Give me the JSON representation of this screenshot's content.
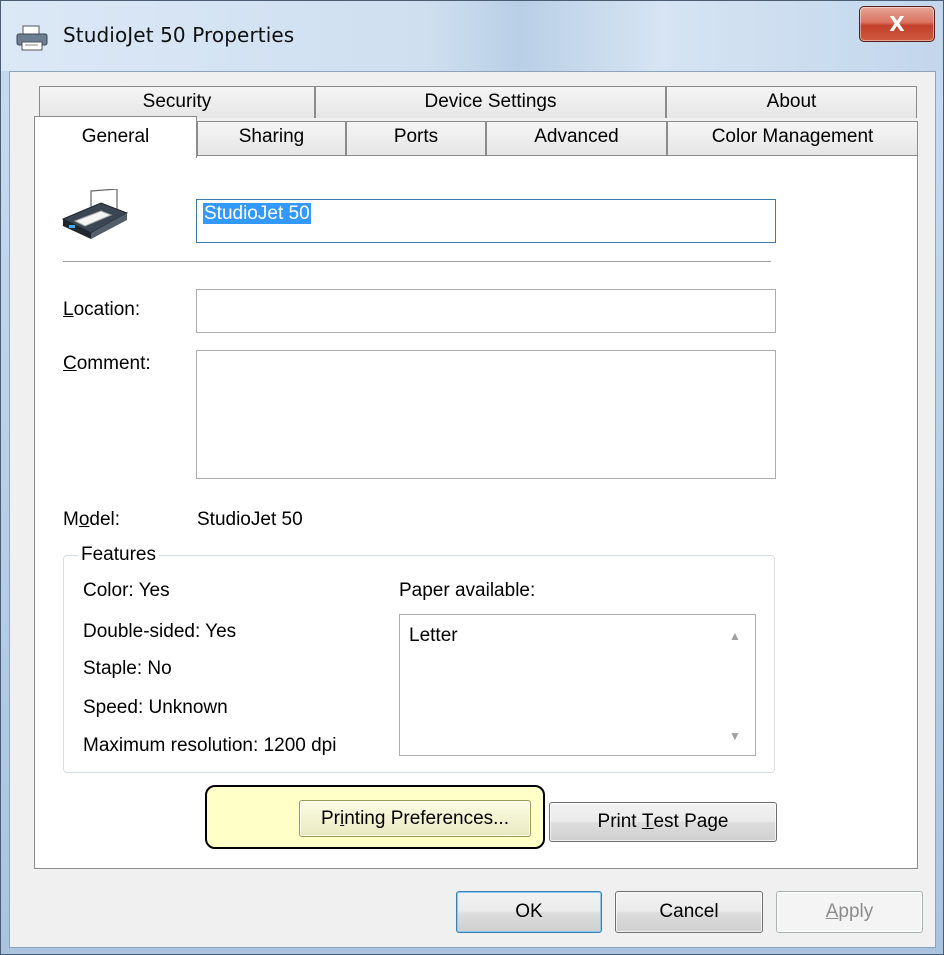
{
  "window": {
    "title": "StudioJet 50 Properties",
    "close_label": "X"
  },
  "tabs": {
    "back_row": [
      "Security",
      "Device Settings",
      "About"
    ],
    "front_row": [
      "General",
      "Sharing",
      "Ports",
      "Advanced",
      "Color Management"
    ],
    "active": "General"
  },
  "general": {
    "printer_name": "StudioJet 50",
    "location_label_u": "L",
    "location_label_rest": "ocation:",
    "location_value": "",
    "comment_label_u": "C",
    "comment_label_rest": "omment:",
    "comment_value": "",
    "model_label_pre": "M",
    "model_label_u": "o",
    "model_label_rest": "del:",
    "model_value": "StudioJet 50"
  },
  "features": {
    "title": "Features",
    "color": "Color: Yes",
    "double_sided": "Double-sided: Yes",
    "staple": "Staple: No",
    "speed": "Speed: Unknown",
    "max_resolution": "Maximum resolution: 1200 dpi",
    "paper_label": "Paper available:",
    "paper_items": [
      "Letter"
    ]
  },
  "buttons": {
    "printing_prefs_pre": "Pr",
    "printing_prefs_u": "i",
    "printing_prefs_rest": "nting Preferences...",
    "print_test_pre": "Print ",
    "print_test_u": "T",
    "print_test_rest": "est Page",
    "ok": "OK",
    "cancel": "Cancel",
    "apply_u": "A",
    "apply_rest": "pply"
  }
}
